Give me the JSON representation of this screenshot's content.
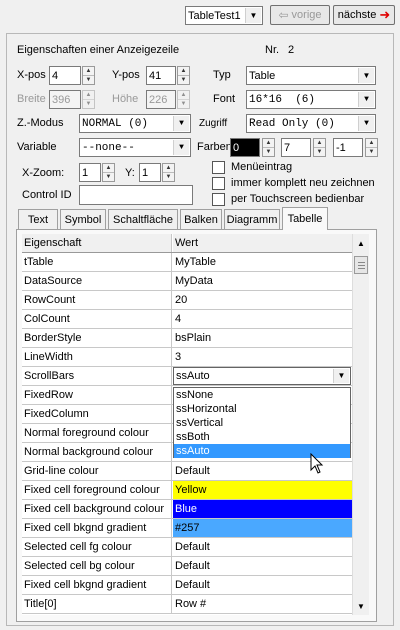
{
  "nav": {
    "current": "TableTest1",
    "prev_label": "vorige",
    "next_label": "nächste"
  },
  "panel": {
    "title": "Eigenschaften einer Anzeigezeile",
    "nr_label": "Nr.",
    "nr_value": "2"
  },
  "props": {
    "xpos_label": "X-pos",
    "xpos": "4",
    "ypos_label": "Y-pos",
    "ypos": "41",
    "typ_label": "Typ",
    "typ": "Table",
    "breite_label": "Breite",
    "breite": "396",
    "hoehe_label": "Höhe",
    "hoehe": "226",
    "font_label": "Font",
    "font": "16*16  (6)",
    "zmodus_label": "Z.-Modus",
    "zmodus": "NORMAL (0)",
    "zugriff_label": "Zugriff",
    "zugriff": "Read Only (0)",
    "variable_label": "Variable",
    "variable": "--none--",
    "farben_label": "Farben",
    "farbe1": "0",
    "farbe2": "7",
    "farbe3": "-1",
    "xzoom_label": "X-Zoom:",
    "xzoom": "1",
    "y_label": "Y:",
    "yzoom": "1",
    "controlid_label": "Control ID",
    "controlid": "",
    "cb_menue": "Menüeintrag",
    "cb_komplett": "immer komplett neu zeichnen",
    "cb_touch": "per Touchscreen bedienbar"
  },
  "tabs": [
    "Text",
    "Symbol",
    "Schaltfläche",
    "Balken",
    "Diagramm",
    "Tabelle"
  ],
  "grid": {
    "col1": "Eigenschaft",
    "col2": "Wert",
    "rows": [
      [
        "tTable",
        "MyTable"
      ],
      [
        "DataSource",
        "MyData"
      ],
      [
        "RowCount",
        "20"
      ],
      [
        "ColCount",
        "4"
      ],
      [
        "BorderStyle",
        "bsPlain"
      ],
      [
        "LineWidth",
        "3"
      ],
      [
        "ScrollBars",
        "ssAuto"
      ],
      [
        "FixedRow",
        ""
      ],
      [
        "FixedColumn",
        ""
      ],
      [
        "Normal foreground colour",
        ""
      ],
      [
        "Normal background colour",
        ""
      ],
      [
        "Grid-line colour",
        "Default"
      ],
      [
        "Fixed cell foreground colour",
        "Yellow"
      ],
      [
        "Fixed cell background colour",
        "Blue"
      ],
      [
        "Fixed cell bkgnd gradient",
        "#257"
      ],
      [
        "Selected cell fg colour",
        "Default"
      ],
      [
        "Selected cell bg colour",
        "Default"
      ],
      [
        "Fixed cell bkgnd gradient",
        "Default"
      ],
      [
        "Title[0]",
        "Row #"
      ]
    ]
  },
  "dropdown": {
    "options": [
      "ssNone",
      "ssHorizontal",
      "ssVertical",
      "ssBoth",
      "ssAuto"
    ],
    "selected": "ssAuto"
  },
  "colors": {
    "yellow": "#ffff00",
    "blue": "#0000ff",
    "gradient": "#4aa8ff",
    "selection": "#3399ff",
    "farbe1_bg": "#000000"
  }
}
